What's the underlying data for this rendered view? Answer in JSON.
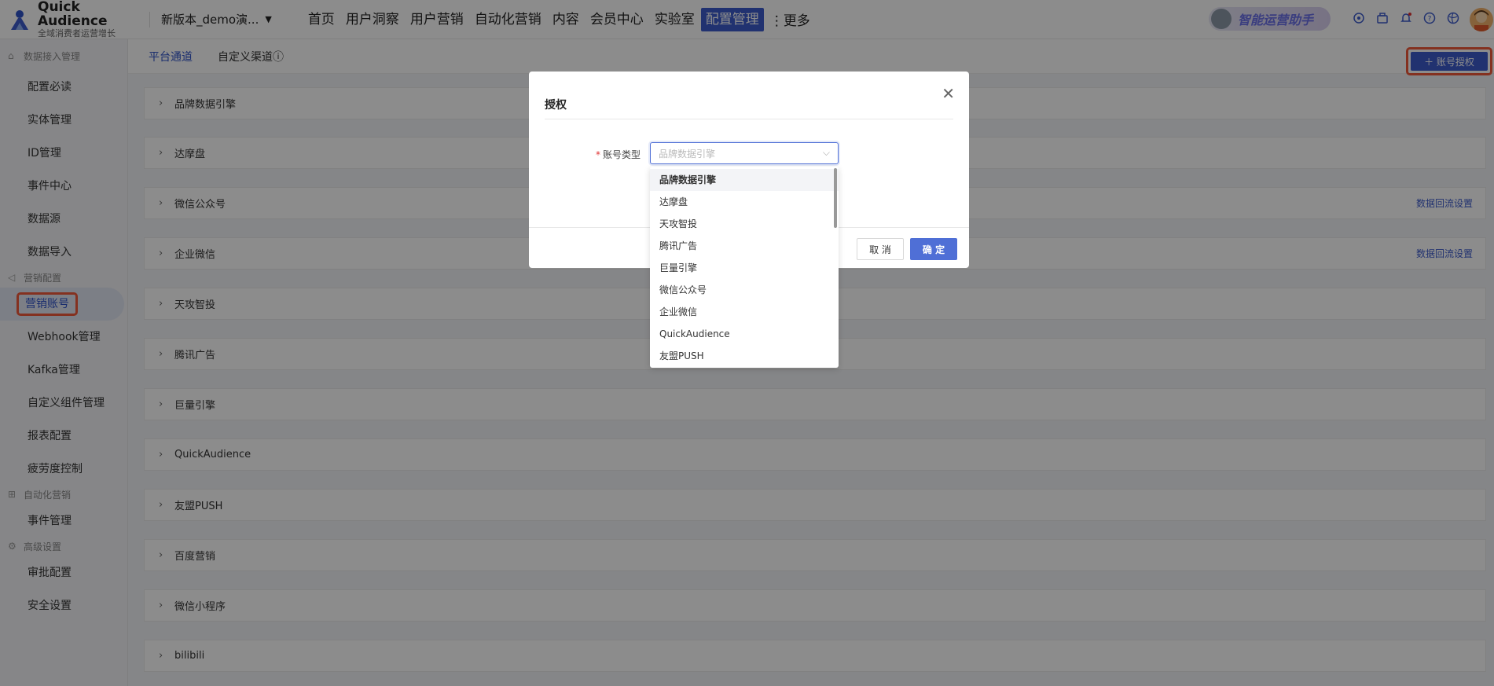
{
  "app": {
    "name": "Quick Audience",
    "subtitle": "全域消费者运营增长"
  },
  "workspace": {
    "name": "新版本_demo演..."
  },
  "nav": {
    "items": [
      {
        "label": "首页"
      },
      {
        "label": "用户洞察"
      },
      {
        "label": "用户营销"
      },
      {
        "label": "自动化营销"
      },
      {
        "label": "内容"
      },
      {
        "label": "会员中心"
      },
      {
        "label": "实验室"
      },
      {
        "label": "配置管理"
      }
    ],
    "more": "⋮更多"
  },
  "assistant": {
    "label": "智能运营助手"
  },
  "sidebar": {
    "sections": [
      {
        "title": "数据接入管理",
        "items": [
          "配置必读",
          "实体管理",
          "ID管理",
          "事件中心",
          "数据源",
          "数据导入"
        ]
      },
      {
        "title": "营销配置",
        "items": [
          "营销账号",
          "Webhook管理",
          "Kafka管理",
          "自定义组件管理",
          "报表配置",
          "疲劳度控制"
        ]
      },
      {
        "title": "自动化营销",
        "items": [
          "事件管理"
        ]
      },
      {
        "title": "高级设置",
        "items": [
          "审批配置",
          "安全设置"
        ]
      }
    ]
  },
  "tabs": {
    "platform": "平台通道",
    "custom": "自定义渠道ⓘ"
  },
  "auth_button": "＋ 账号授权",
  "panels": [
    {
      "label": "品牌数据引擎",
      "link": ""
    },
    {
      "label": "达摩盘",
      "link": ""
    },
    {
      "label": "微信公众号",
      "link": "数据回流设置"
    },
    {
      "label": "企业微信",
      "link": "数据回流设置"
    },
    {
      "label": "天攻智投",
      "link": ""
    },
    {
      "label": "腾讯广告",
      "link": ""
    },
    {
      "label": "巨量引擎",
      "link": ""
    },
    {
      "label": "QuickAudience",
      "link": ""
    },
    {
      "label": "友盟PUSH",
      "link": ""
    },
    {
      "label": "百度营销",
      "link": ""
    },
    {
      "label": "微信小程序",
      "link": ""
    },
    {
      "label": "bilibili",
      "link": ""
    }
  ],
  "modal": {
    "title": "授权",
    "field_label": "账号类型",
    "placeholder": "品牌数据引擎",
    "cancel": "取 消",
    "ok": "确 定",
    "options": [
      "品牌数据引擎",
      "达摩盘",
      "天攻智投",
      "腾讯广告",
      "巨量引擎",
      "微信公众号",
      "企业微信",
      "QuickAudience",
      "友盟PUSH"
    ]
  },
  "colors": {
    "accent": "#3d5bcc",
    "highlight": "#f15a3b"
  }
}
